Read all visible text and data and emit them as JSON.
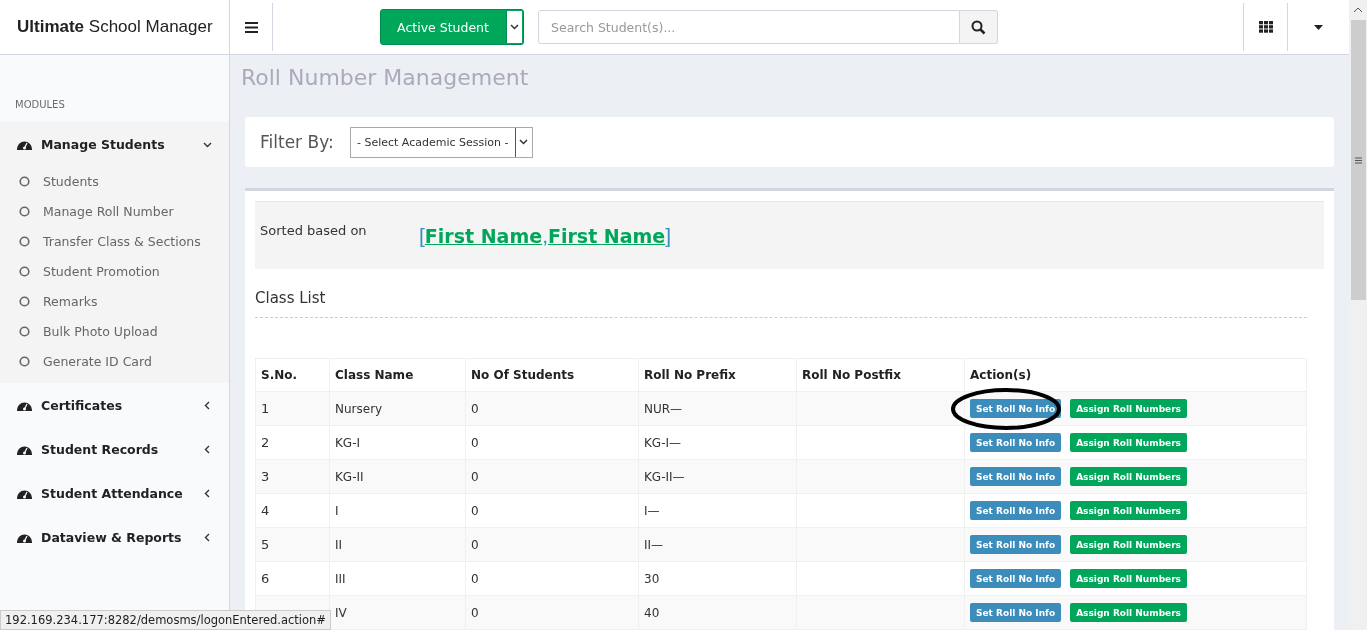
{
  "header": {
    "brand_bold": "Ultimate",
    "brand_rest": "School Manager",
    "student_filter": "Active Student",
    "search": {
      "placeholder": "Search Student(s)..."
    }
  },
  "sidebar": {
    "section": "MODULES",
    "groups": [
      {
        "label": "Manage Students",
        "expanded": true,
        "children": [
          {
            "label": "Students"
          },
          {
            "label": "Manage Roll Number"
          },
          {
            "label": "Transfer Class & Sections"
          },
          {
            "label": "Student Promotion"
          },
          {
            "label": "Remarks"
          },
          {
            "label": "Bulk Photo Upload"
          },
          {
            "label": "Generate ID Card"
          }
        ]
      },
      {
        "label": "Certificates",
        "expanded": false
      },
      {
        "label": "Student Records",
        "expanded": false
      },
      {
        "label": "Student Attendance",
        "expanded": false
      },
      {
        "label": "Dataview & Reports",
        "expanded": false
      }
    ]
  },
  "page_title": "Roll Number Management",
  "filter": {
    "label": "Filter By:",
    "session": "- Select Academic Session -"
  },
  "sorted": {
    "label": "Sorted based on",
    "open": "[",
    "fields": [
      "First Name",
      "First Name"
    ],
    "separator": ",",
    "close": "]"
  },
  "class_list": {
    "title": "Class List",
    "columns": [
      "S.No.",
      "Class Name",
      "No Of Students",
      "Roll No Prefix",
      "Roll No Postfix",
      "Action(s)"
    ],
    "rows": [
      {
        "sno": "1",
        "class_name": "Nursery",
        "students": "0",
        "prefix": "NUR—",
        "highlighted": true,
        "actions": [
          "Set Roll No Info",
          "Assign Roll Numbers"
        ]
      },
      {
        "sno": "2",
        "class_name": "KG-I",
        "students": "0",
        "prefix": "KG-I—",
        "highlighted": false,
        "actions": [
          "Set Roll No Info",
          "Assign Roll Numbers"
        ]
      },
      {
        "sno": "3",
        "class_name": "KG-II",
        "students": "0",
        "prefix": "KG-II—",
        "highlighted": false,
        "actions": [
          "Set Roll No Info",
          "Assign Roll Numbers"
        ]
      },
      {
        "sno": "4",
        "class_name": "I",
        "students": "0",
        "prefix": "I—",
        "highlighted": false,
        "actions": [
          "Set Roll No Info",
          "Assign Roll Numbers"
        ]
      },
      {
        "sno": "5",
        "class_name": "II",
        "students": "0",
        "prefix": "II—",
        "highlighted": false,
        "actions": [
          "Set Roll No Info",
          "Assign Roll Numbers"
        ]
      },
      {
        "sno": "6",
        "class_name": "III",
        "students": "0",
        "prefix": "30",
        "highlighted": false,
        "actions": [
          "Set Roll No Info",
          "Assign Roll Numbers"
        ]
      },
      {
        "class_name": "IV",
        "students": "0",
        "prefix": "40",
        "highlighted": false,
        "actions": [
          "Set Roll No Info",
          "Assign Roll Numbers"
        ]
      }
    ]
  },
  "status_url": "192.169.234.177:8282/demosms/logonEntered.action#"
}
